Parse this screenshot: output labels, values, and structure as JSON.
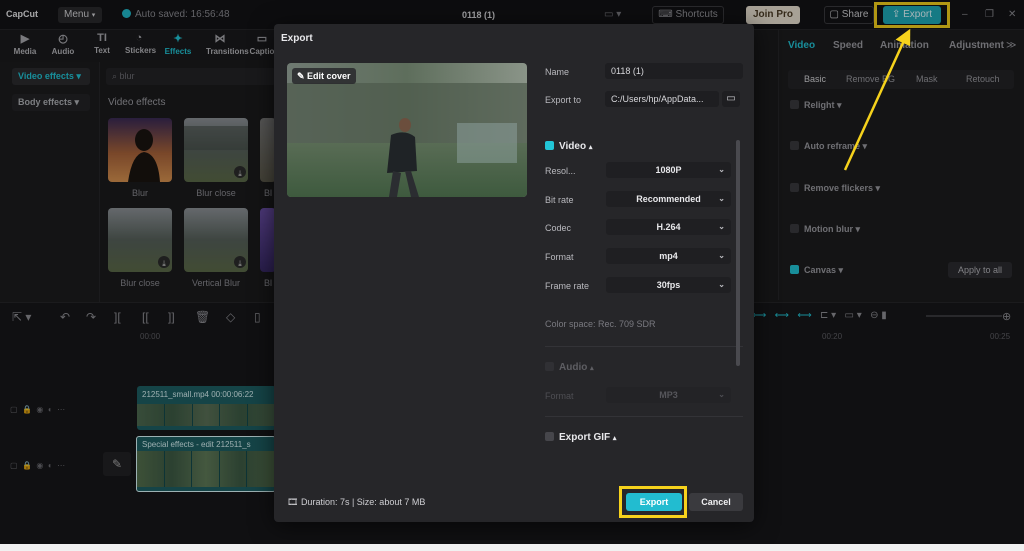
{
  "app": {
    "logo": "CapCut",
    "menu_label": "Menu",
    "autosave": "Auto saved: 16:56:48",
    "project_title": "0118 (1)",
    "shortcuts": "Shortcuts",
    "join_pro": "Join Pro",
    "share": "Share",
    "export": "Export"
  },
  "tools": [
    {
      "label": "Media",
      "icon": "media-icon"
    },
    {
      "label": "Audio",
      "icon": "audio-icon"
    },
    {
      "label": "Text",
      "icon": "text-icon"
    },
    {
      "label": "Stickers",
      "icon": "stickers-icon"
    },
    {
      "label": "Effects",
      "icon": "effects-icon"
    },
    {
      "label": "Transitions",
      "icon": "transitions-icon"
    },
    {
      "label": "Captio",
      "icon": "captions-icon"
    }
  ],
  "effects": {
    "video_effects_tab": "Video effects",
    "body_effects_tab": "Body effects",
    "search_placeholder": "blur",
    "heading": "Video effects",
    "items": [
      "Blur",
      "Blur close",
      "Bl",
      "Blur close",
      "Vertical Blur",
      "Bl"
    ]
  },
  "right_panel": {
    "tabs": [
      "Video",
      "Speed",
      "Animation",
      "Adjustment"
    ],
    "subtabs": [
      "Basic",
      "Remove BG",
      "Mask",
      "Retouch"
    ],
    "rows": [
      "Relight",
      "Auto reframe",
      "Remove flickers",
      "Motion blur",
      "Canvas"
    ],
    "apply_all": "Apply to all"
  },
  "timeline": {
    "ruler": [
      "00:00",
      "00:20",
      "00:25"
    ],
    "clip1_label": "212511_small.mp4  00:00:06:22",
    "clip2_label": "Special effects - edit  212511_s"
  },
  "export_dialog": {
    "title": "Export",
    "edit_cover": "Edit cover",
    "name_label": "Name",
    "name_value": "0118 (1)",
    "export_to_label": "Export to",
    "export_to_value": "C:/Users/hp/AppData...",
    "video_section": "Video",
    "resolution_label": "Resol...",
    "resolution_value": "1080P",
    "bitrate_label": "Bit rate",
    "bitrate_value": "Recommended",
    "codec_label": "Codec",
    "codec_value": "H.264",
    "format_label": "Format",
    "format_value": "mp4",
    "framerate_label": "Frame rate",
    "framerate_value": "30fps",
    "color_space": "Color space: Rec. 709 SDR",
    "audio_section": "Audio",
    "audio_format_label": "Format",
    "audio_format_value": "MP3",
    "gif_section": "Export GIF",
    "duration": "Duration: 7s | Size: about 7 MB",
    "export_button": "Export",
    "cancel_button": "Cancel"
  },
  "colors": {
    "accent": "#22c5d6",
    "highlight": "#f6d21c"
  }
}
